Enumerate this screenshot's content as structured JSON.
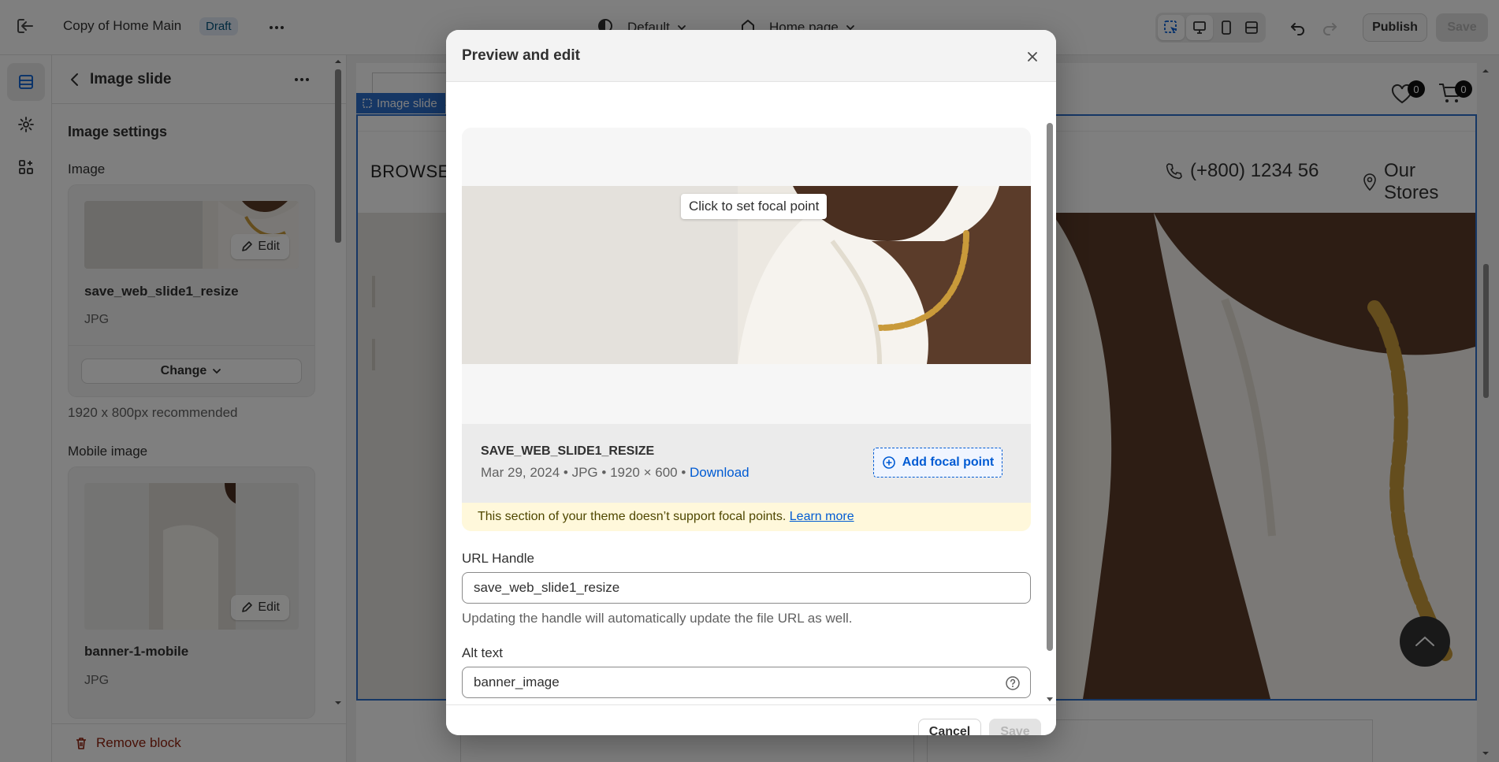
{
  "topbar": {
    "title": "Copy of Home Main",
    "badge": "Draft",
    "theme": "Default",
    "page": "Home page",
    "publish": "Publish",
    "save": "Save"
  },
  "panel": {
    "title": "Image slide",
    "section": "Image settings",
    "image_label": "Image",
    "image": {
      "edit": "Edit",
      "file_name": "save_web_slide1_resize",
      "file_type": "JPG",
      "change": "Change"
    },
    "recommend": "1920 x 800px recommended",
    "mobile_label": "Mobile image",
    "mobile": {
      "edit": "Edit",
      "file_name": "banner-1-mobile",
      "file_type": "JPG"
    },
    "remove": "Remove block"
  },
  "preview": {
    "slide_tag": "Image slide",
    "wishlist_count": "0",
    "cart_count": "0",
    "browse": "BROWSE C",
    "phone": "(+800) 1234 56",
    "stores": "Our Stores"
  },
  "modal": {
    "title": "Preview and edit",
    "focal_tip": "Click to set focal point",
    "file_name": "SAVE_WEB_SLIDE1_RESIZE",
    "date": "Mar 29, 2024",
    "type": "JPG",
    "dimensions": "1920 × 600",
    "download": "Download",
    "add_focal": "Add focal point",
    "warning": "This section of your theme doesn’t support focal points.",
    "learn_more": "Learn more",
    "url_label": "URL Handle",
    "url_value": "save_web_slide1_resize",
    "url_help": "Updating the handle will automatically update the file URL as well.",
    "alt_label": "Alt text",
    "alt_value": "banner_image",
    "cancel": "Cancel",
    "save": "Save"
  },
  "colors": {
    "accent": "#005bd3",
    "selection": "#2c6ecb",
    "warning_bg": "#fff8db"
  }
}
